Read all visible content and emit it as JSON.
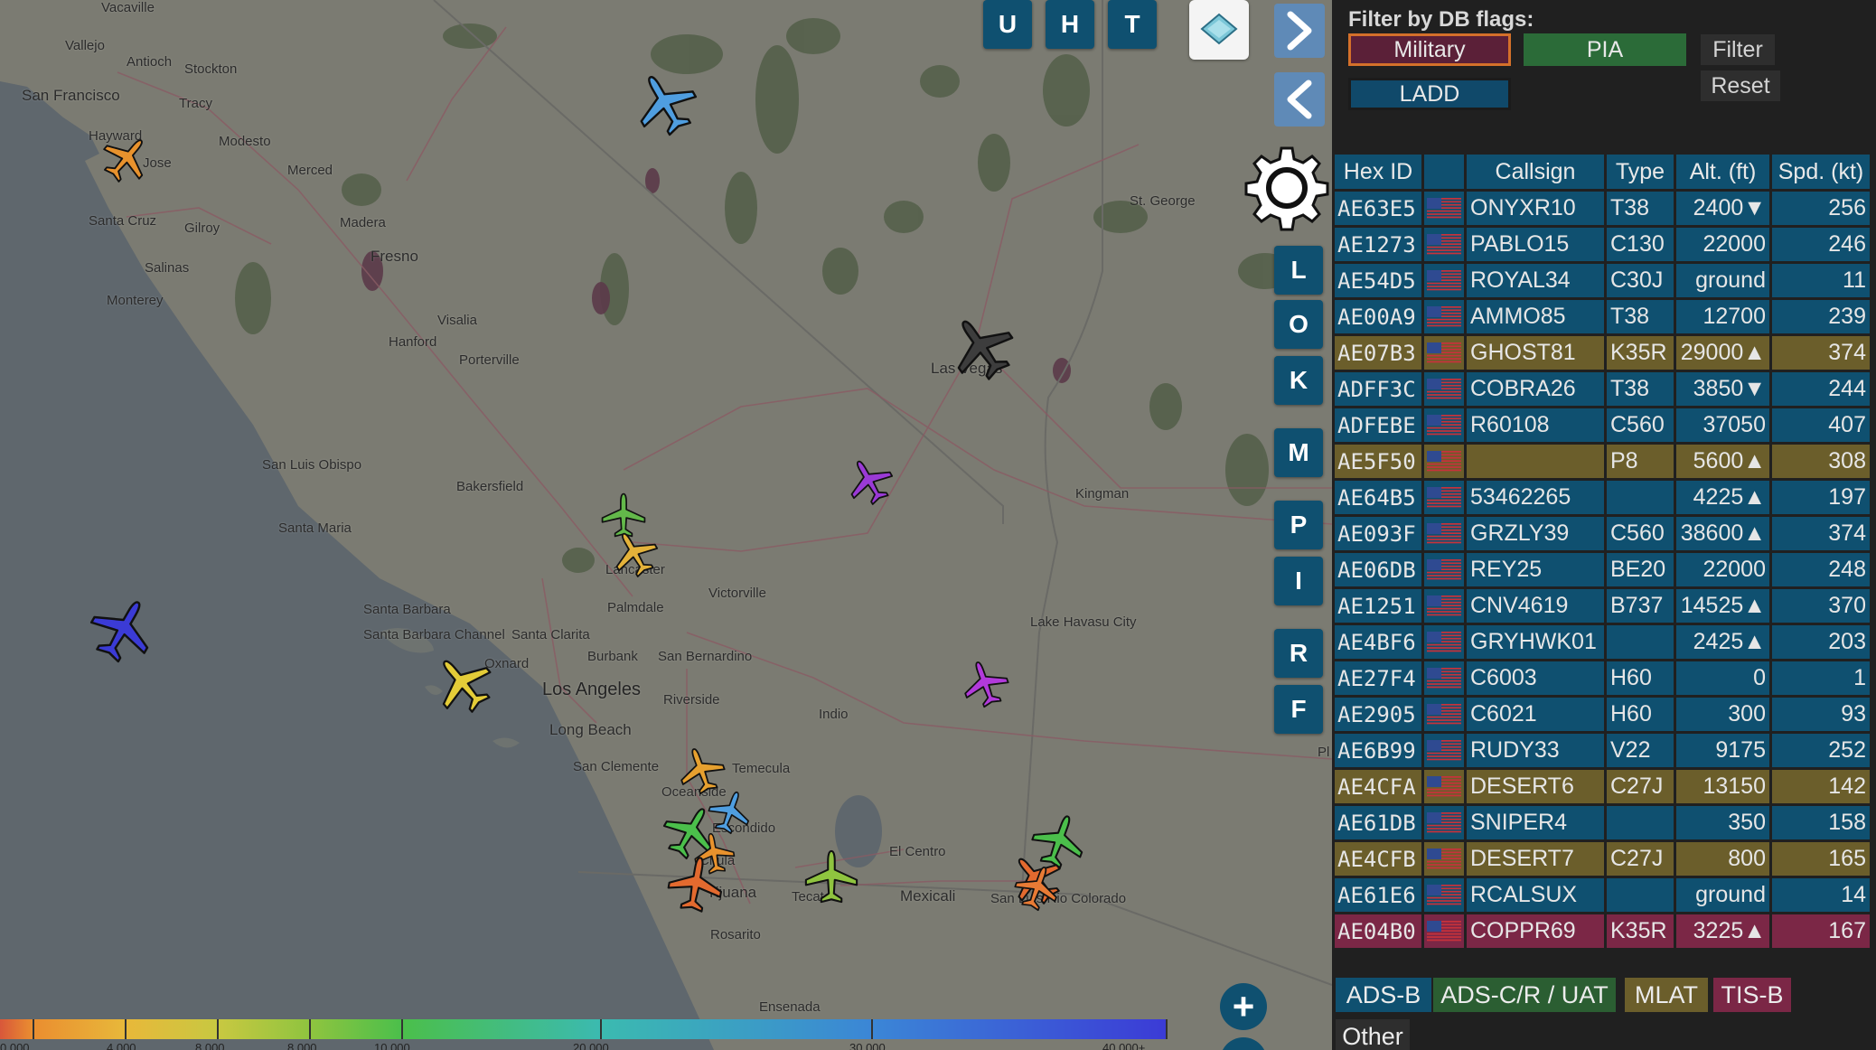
{
  "map": {
    "cities": [
      {
        "name": "Vacaville",
        "cls": ""
      },
      {
        "name": "Vallejo",
        "cls": ""
      },
      {
        "name": "Stockton",
        "cls": ""
      },
      {
        "name": "Antioch",
        "cls": ""
      },
      {
        "name": "San Francisco",
        "cls": "mid"
      },
      {
        "name": "Tracy",
        "cls": ""
      },
      {
        "name": "Hayward",
        "cls": ""
      },
      {
        "name": "Modesto",
        "cls": ""
      },
      {
        "name": "Jose",
        "cls": ""
      },
      {
        "name": "Merced",
        "cls": ""
      },
      {
        "name": "Santa Cruz",
        "cls": ""
      },
      {
        "name": "Gilroy",
        "cls": ""
      },
      {
        "name": "Madera",
        "cls": ""
      },
      {
        "name": "Fresno",
        "cls": "mid"
      },
      {
        "name": "Salinas",
        "cls": ""
      },
      {
        "name": "Monterey",
        "cls": ""
      },
      {
        "name": "Visalia",
        "cls": ""
      },
      {
        "name": "Hanford",
        "cls": ""
      },
      {
        "name": "Porterville",
        "cls": ""
      },
      {
        "name": "St. George",
        "cls": ""
      },
      {
        "name": "Las Vegas",
        "cls": "mid"
      },
      {
        "name": "San Luis Obispo",
        "cls": ""
      },
      {
        "name": "Bakersfield",
        "cls": ""
      },
      {
        "name": "Santa Maria",
        "cls": ""
      },
      {
        "name": "Kingman",
        "cls": ""
      },
      {
        "name": "Lancaster",
        "cls": ""
      },
      {
        "name": "Victorville",
        "cls": ""
      },
      {
        "name": "Palmdale",
        "cls": ""
      },
      {
        "name": "Santa Barbara",
        "cls": ""
      },
      {
        "name": "Santa Clarita",
        "cls": ""
      },
      {
        "name": "Oxnard",
        "cls": ""
      },
      {
        "name": "Burbank",
        "cls": ""
      },
      {
        "name": "San Bernardino",
        "cls": ""
      },
      {
        "name": "Los Angeles",
        "cls": "big"
      },
      {
        "name": "Riverside",
        "cls": ""
      },
      {
        "name": "Long Beach",
        "cls": "mid"
      },
      {
        "name": "Lake Havasu City",
        "cls": ""
      },
      {
        "name": "Indio",
        "cls": ""
      },
      {
        "name": "San Clemente",
        "cls": ""
      },
      {
        "name": "Temecula",
        "cls": ""
      },
      {
        "name": "Oceanside",
        "cls": ""
      },
      {
        "name": "Escondido",
        "cls": ""
      },
      {
        "name": "El Centro",
        "cls": ""
      },
      {
        "name": "Mexicali",
        "cls": "mid"
      },
      {
        "name": "Tecate",
        "cls": ""
      },
      {
        "name": "Tijuana",
        "cls": "mid"
      },
      {
        "name": "Rosarito",
        "cls": ""
      },
      {
        "name": "San Luis Rio Colorado",
        "cls": ""
      },
      {
        "name": "Ensenada",
        "cls": ""
      },
      {
        "name": "Santa Barbara Channel",
        "cls": ""
      },
      {
        "name": "Chula",
        "cls": ""
      },
      {
        "name": "Pl",
        "cls": ""
      }
    ],
    "top_buttons": [
      "U",
      "H",
      "T"
    ],
    "side_buttons": [
      "L",
      "O",
      "K",
      "M",
      "P",
      "I",
      "R",
      "F"
    ],
    "colorbar_labels": [
      "0.000",
      "4.000",
      "8.000",
      "8.000",
      "10.000",
      "20.000",
      "30.000",
      "40.000+"
    ],
    "colorbar_colors": [
      "#d8573a",
      "#ea8e30",
      "#e8b83a",
      "#c8c841",
      "#8fc43f",
      "#4bbf4b",
      "#3bbab0",
      "#3b86d6",
      "#3b3bd6",
      "#8a35e8",
      "#c32fe0"
    ]
  },
  "sidebar": {
    "filter_title": "Filter by DB flags:",
    "buttons": {
      "military": "Military",
      "pia": "PIA",
      "ladd": "LADD",
      "filter": "Filter",
      "reset": "Reset"
    },
    "columns": [
      "Hex ID",
      "",
      "Callsign",
      "Type",
      "Alt. (ft)",
      "Spd. (kt)"
    ],
    "rows": [
      {
        "hex": "AE63E5",
        "callsign": "ONYXR10",
        "type": "T38",
        "alt": "2400▼",
        "spd": "256",
        "style": ""
      },
      {
        "hex": "AE1273",
        "callsign": "PABLO15",
        "type": "C130",
        "alt": "22000",
        "spd": "246",
        "style": ""
      },
      {
        "hex": "AE54D5",
        "callsign": "ROYAL34",
        "type": "C30J",
        "alt": "ground",
        "spd": "11",
        "style": ""
      },
      {
        "hex": "AE00A9",
        "callsign": "AMMO85",
        "type": "T38",
        "alt": "12700",
        "spd": "239",
        "style": ""
      },
      {
        "hex": "AE07B3",
        "callsign": "GHOST81",
        "type": "K35R",
        "alt": "29000▲",
        "spd": "374",
        "style": "row-y"
      },
      {
        "hex": "ADFF3C",
        "callsign": "COBRA26",
        "type": "T38",
        "alt": "3850▼",
        "spd": "244",
        "style": ""
      },
      {
        "hex": "ADFEBE",
        "callsign": "R60108",
        "type": "C560",
        "alt": "37050",
        "spd": "407",
        "style": ""
      },
      {
        "hex": "AE5F50",
        "callsign": "",
        "type": "P8",
        "alt": "5600▲",
        "spd": "308",
        "style": "row-y"
      },
      {
        "hex": "AE64B5",
        "callsign": "53462265",
        "type": "",
        "alt": "4225▲",
        "spd": "197",
        "style": ""
      },
      {
        "hex": "AE093F",
        "callsign": "GRZLY39",
        "type": "C560",
        "alt": "38600▲",
        "spd": "374",
        "style": ""
      },
      {
        "hex": "AE06DB",
        "callsign": "REY25",
        "type": "BE20",
        "alt": "22000",
        "spd": "248",
        "style": ""
      },
      {
        "hex": "AE1251",
        "callsign": "CNV4619",
        "type": "B737",
        "alt": "14525▲",
        "spd": "370",
        "style": ""
      },
      {
        "hex": "AE4BF6",
        "callsign": "GRYHWK01",
        "type": "",
        "alt": "2425▲",
        "spd": "203",
        "style": ""
      },
      {
        "hex": "AE27F4",
        "callsign": "C6003",
        "type": "H60",
        "alt": "0",
        "spd": "1",
        "style": ""
      },
      {
        "hex": "AE2905",
        "callsign": "C6021",
        "type": "H60",
        "alt": "300",
        "spd": "93",
        "style": ""
      },
      {
        "hex": "AE6B99",
        "callsign": "RUDY33",
        "type": "V22",
        "alt": "9175",
        "spd": "252",
        "style": ""
      },
      {
        "hex": "AE4CFA",
        "callsign": "DESERT6",
        "type": "C27J",
        "alt": "13150",
        "spd": "142",
        "style": "row-y"
      },
      {
        "hex": "AE61DB",
        "callsign": "SNIPER4",
        "type": "",
        "alt": "350",
        "spd": "158",
        "style": ""
      },
      {
        "hex": "AE4CFB",
        "callsign": "DESERT7",
        "type": "C27J",
        "alt": "800",
        "spd": "165",
        "style": "row-y"
      },
      {
        "hex": "AE61E6",
        "callsign": "RCALSUX",
        "type": "",
        "alt": "ground",
        "spd": "14",
        "style": ""
      },
      {
        "hex": "AE04B0",
        "callsign": "COPPR69",
        "type": "K35R",
        "alt": "3225▲",
        "spd": "167",
        "style": "row-r"
      }
    ],
    "legend": [
      "ADS-B",
      "ADS-C/R / UAT",
      "MLAT",
      "TIS-B",
      "Other"
    ]
  },
  "colors": {
    "accent": "#0f5070",
    "military_bg": "#5b2038",
    "military_border": "#d4702a",
    "pia": "#2b6b38",
    "ladd": "#10496a",
    "row_mil_yellow": "#6b5e2b",
    "row_red": "#7b2746"
  }
}
